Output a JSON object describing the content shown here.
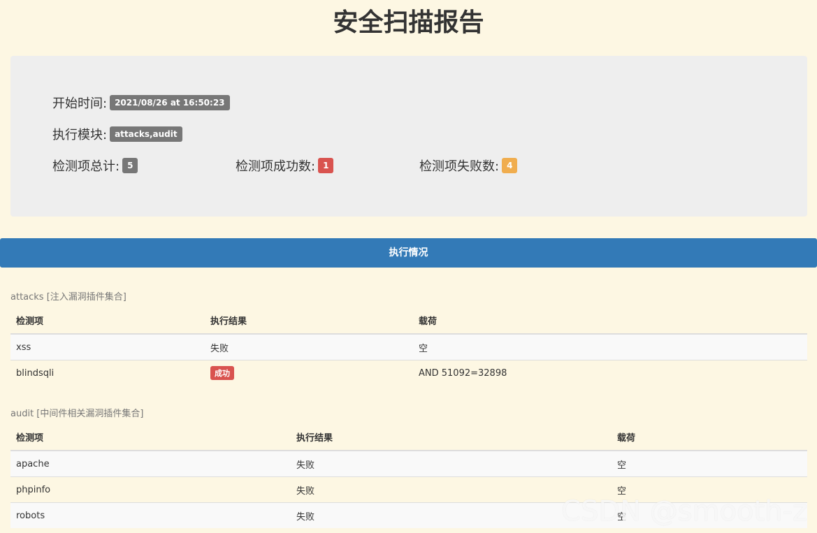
{
  "title": "安全扫描报告",
  "summary": {
    "start_label": "开始时间:",
    "start_value": "2021/08/26 at 16:50:23",
    "module_label": "执行模块:",
    "module_value": "attacks,audit",
    "total_label": "检测项总计:",
    "total_value": "5",
    "success_label": "检测项成功数:",
    "success_value": "1",
    "fail_label": "检测项失败数:",
    "fail_value": "4"
  },
  "exec_bar": "执行情况",
  "sections": [
    {
      "caption": "attacks [注入漏洞插件集合]",
      "headers": [
        "检测项",
        "执行结果",
        "载荷"
      ],
      "rows": [
        {
          "item": "xss",
          "result": "失败",
          "payload": "空"
        },
        {
          "item": "blindsqli",
          "result": "成功",
          "payload": "AND 51092=32898"
        }
      ]
    },
    {
      "caption": "audit [中间件相关漏洞插件集合]",
      "headers": [
        "检测项",
        "执行结果",
        "载荷"
      ],
      "rows": [
        {
          "item": "apache",
          "result": "失败",
          "payload": "空"
        },
        {
          "item": "phpinfo",
          "result": "失败",
          "payload": "空"
        },
        {
          "item": "robots",
          "result": "失败",
          "payload": "空"
        }
      ]
    }
  ],
  "watermark": "CSDN @smooth-z",
  "colors": {
    "background": "#fdf7e3",
    "panel": "#eeeeee",
    "primary": "#337ab7",
    "badge_gray": "#777777",
    "badge_red": "#d9534f",
    "badge_orange": "#f0ad4e"
  }
}
